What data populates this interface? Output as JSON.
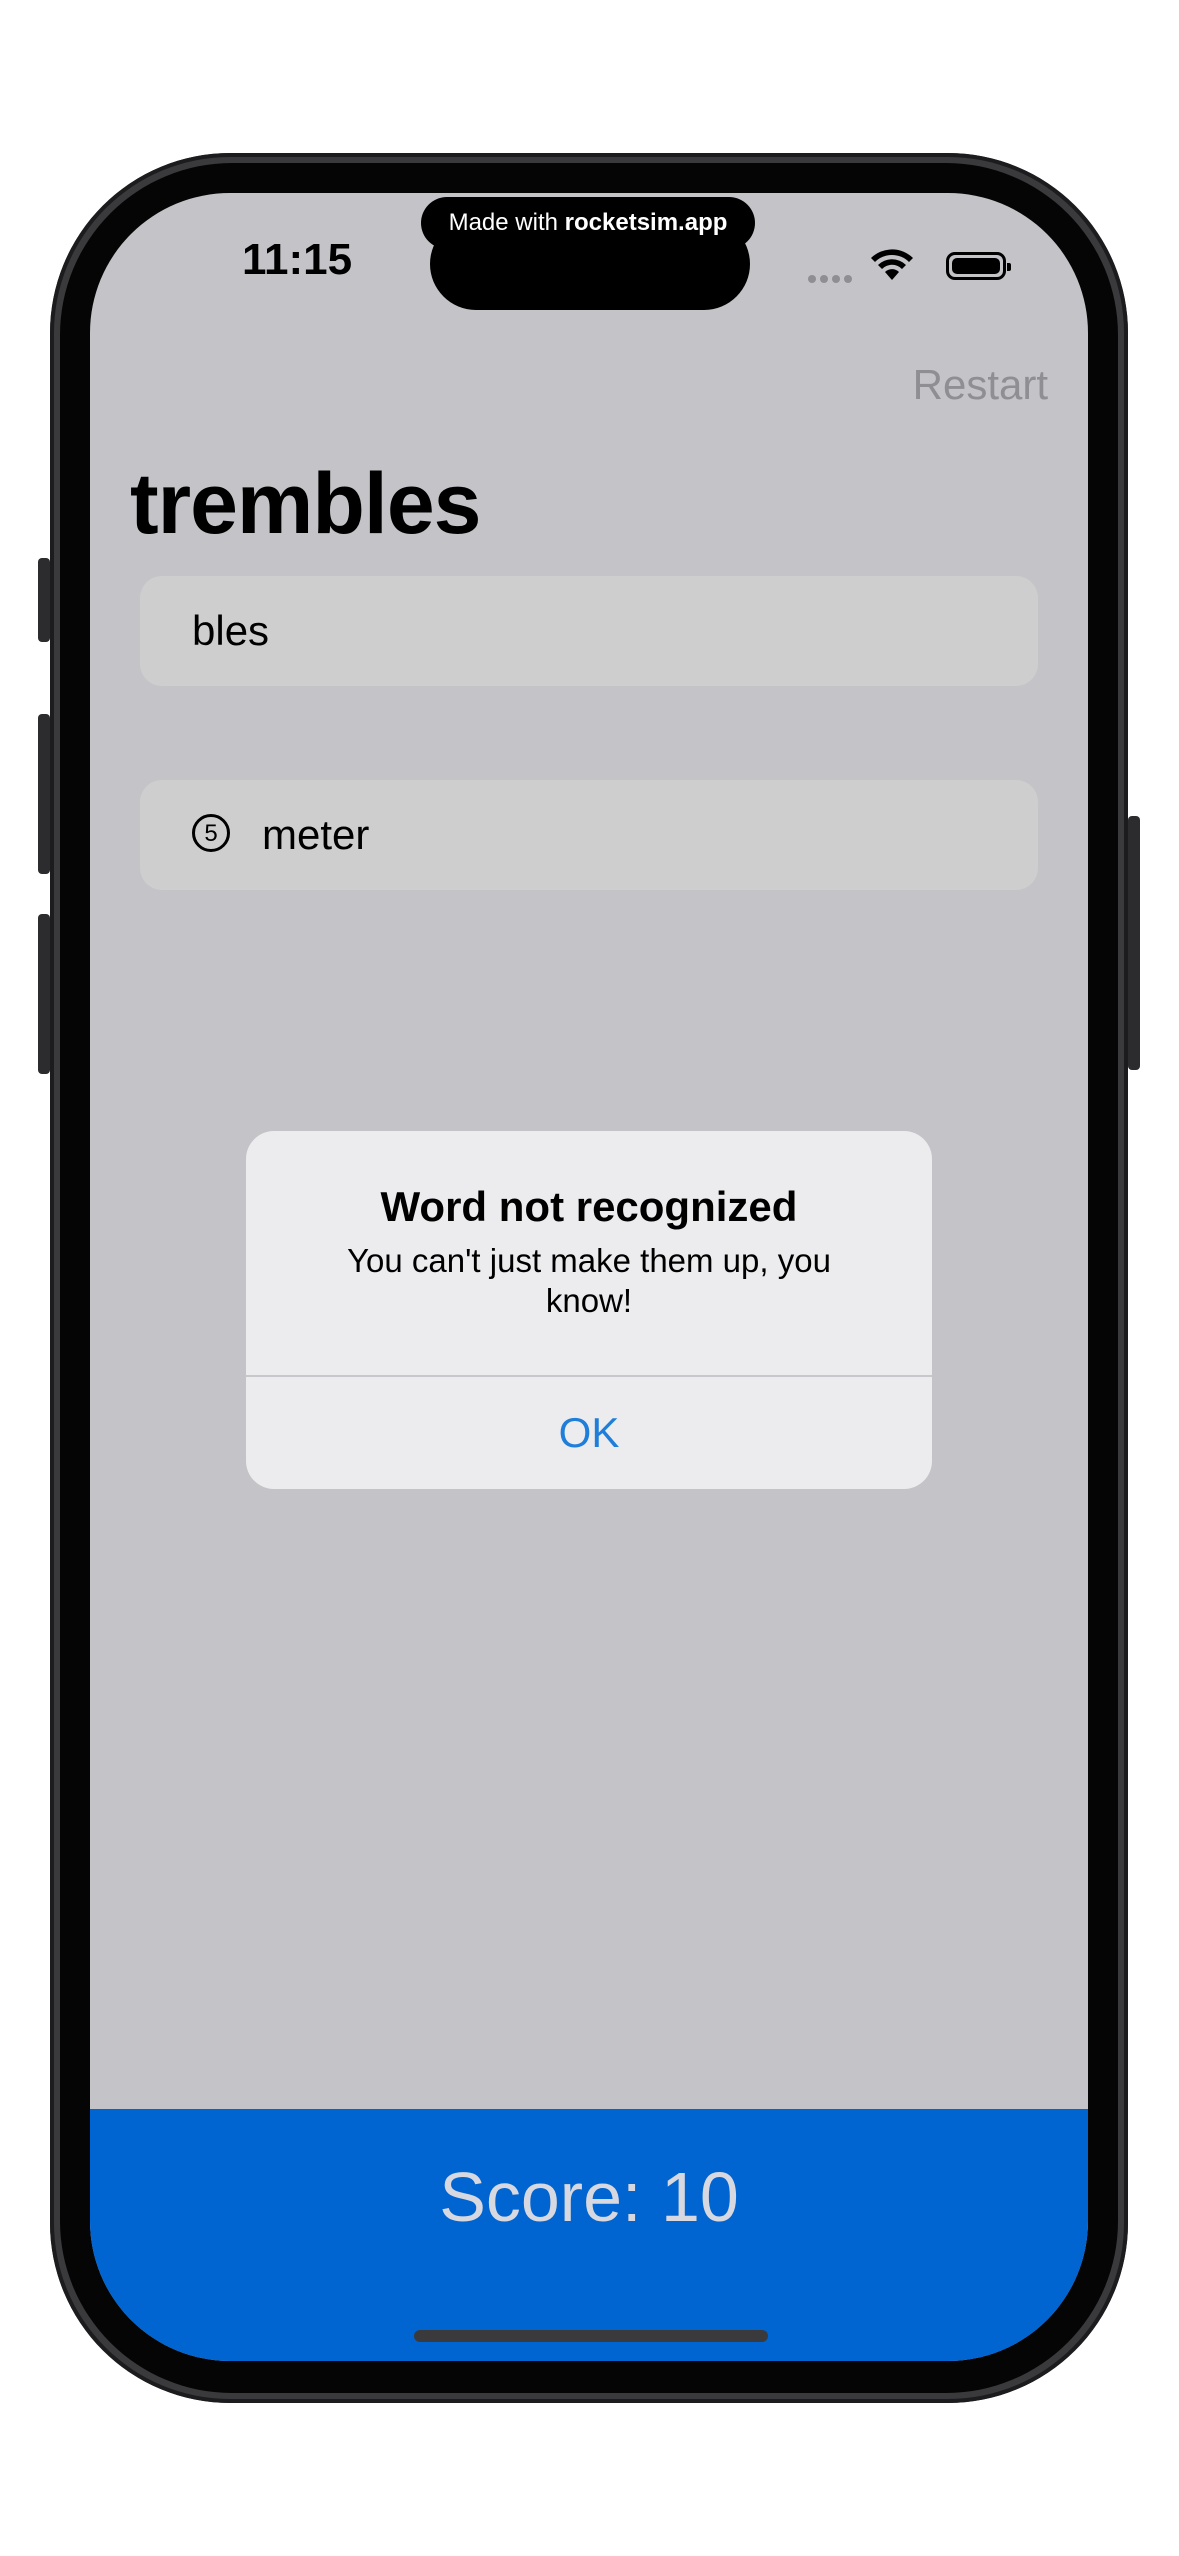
{
  "status_bar": {
    "time": "11:15",
    "banner_prefix": "Made with ",
    "banner_brand": "rocketsim.app"
  },
  "nav": {
    "restart_label": "Restart"
  },
  "game": {
    "root_word": "trembles",
    "input_value": "bles",
    "entries": [
      {
        "length": "5",
        "word": "meter"
      }
    ]
  },
  "alert": {
    "title": "Word not recognized",
    "message": "You can't just make them up, you know!",
    "ok_label": "OK"
  },
  "footer": {
    "score_text": "Score: 10"
  },
  "colors": {
    "background": "#c4c3c8",
    "accent": "#0064d1",
    "link": "#1e7ed9"
  }
}
